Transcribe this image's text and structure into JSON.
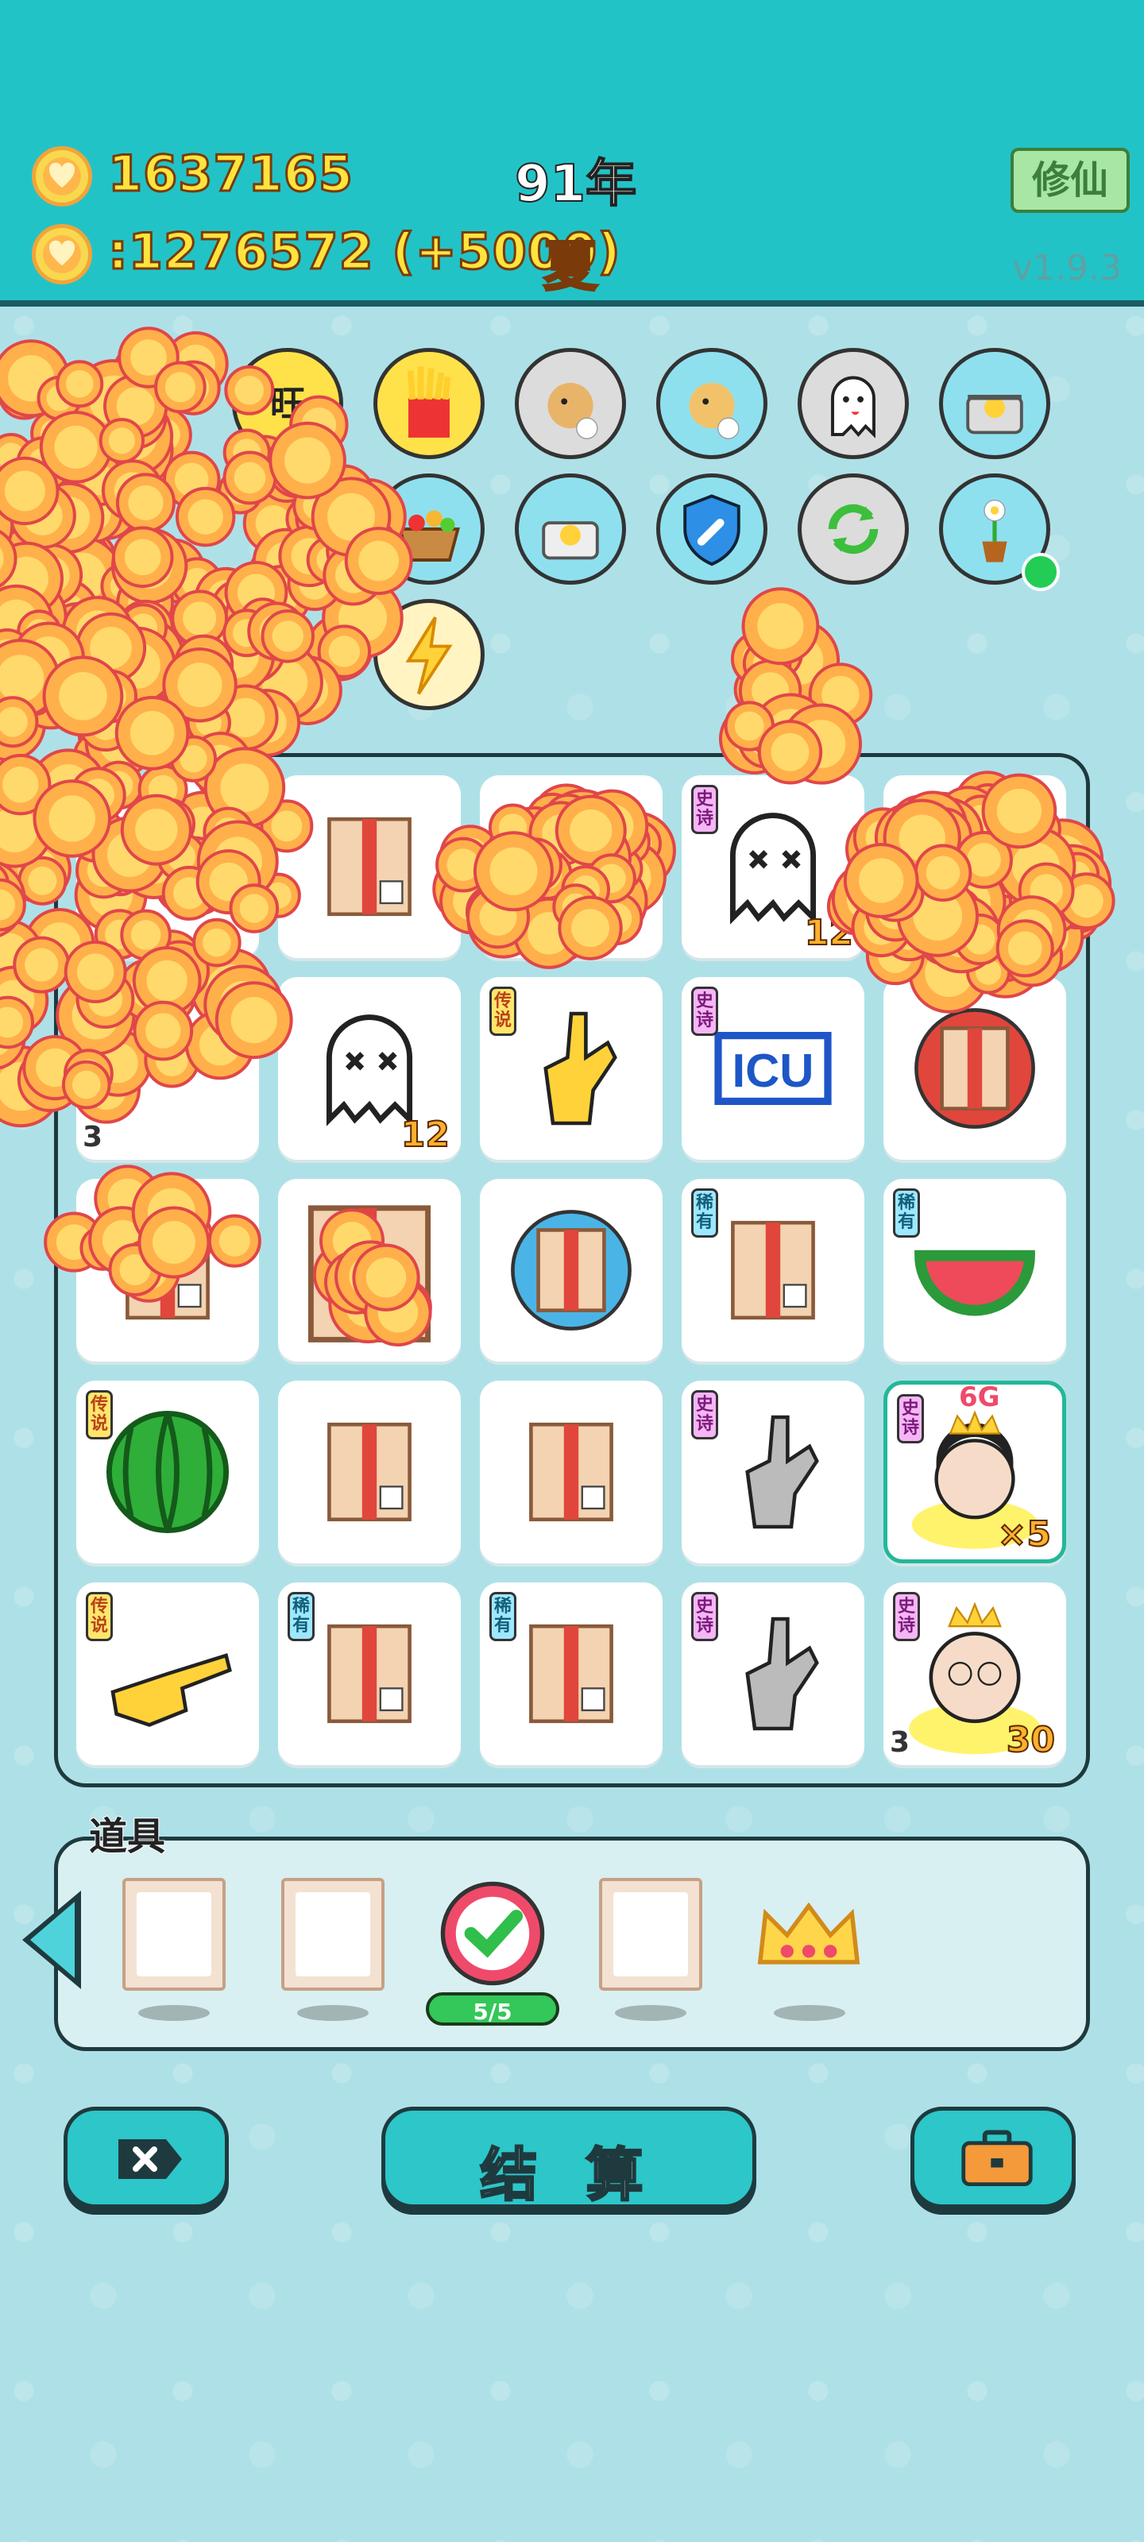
{
  "header": {
    "coins": "1637165",
    "year": "91年",
    "income": ":1276572 (+5000)",
    "season": "夏",
    "xiuxian_label": "修仙",
    "version": "v1.9.3"
  },
  "top_icons": [
    {
      "name": "wang-coin-icon"
    },
    {
      "name": "fries-icon"
    },
    {
      "name": "chicken-egg-icon"
    },
    {
      "name": "chick-egg-icon"
    },
    {
      "name": "ghost-icon"
    },
    {
      "name": "pot-icon"
    },
    {
      "name": "fruit-basket-icon"
    },
    {
      "name": "duck-pot-icon"
    },
    {
      "name": "shield-wrench-icon"
    },
    {
      "name": "recycle-icon"
    },
    {
      "name": "flower-pot-icon"
    },
    {
      "name": "lightning-icon"
    }
  ],
  "board": {
    "cells": [
      {
        "row": 0,
        "col": 0,
        "item": "hidden",
        "tag": "",
        "count": ""
      },
      {
        "row": 0,
        "col": 1,
        "item": "box",
        "tag": "",
        "count": ""
      },
      {
        "row": 0,
        "col": 2,
        "item": "hidden",
        "tag": "",
        "count": ""
      },
      {
        "row": 0,
        "col": 3,
        "item": "ghost",
        "tag": "史诗",
        "tagtype": "epic",
        "count": "12"
      },
      {
        "row": 0,
        "col": 4,
        "item": "hidden",
        "tag": "",
        "count": ""
      },
      {
        "row": 1,
        "col": 0,
        "item": "hidden",
        "tag": "",
        "count": "",
        "small": "3"
      },
      {
        "row": 1,
        "col": 1,
        "item": "ghost",
        "tag": "",
        "count": "12"
      },
      {
        "row": 1,
        "col": 2,
        "item": "hand-yellow",
        "tag": "传说",
        "tagtype": "legend",
        "count": ""
      },
      {
        "row": 1,
        "col": 3,
        "item": "icu",
        "tag": "史诗",
        "tagtype": "epic",
        "count": ""
      },
      {
        "row": 1,
        "col": 4,
        "item": "box-red",
        "tag": "",
        "count": ""
      },
      {
        "row": 2,
        "col": 0,
        "item": "box",
        "tag": "",
        "count": ""
      },
      {
        "row": 2,
        "col": 1,
        "item": "box-big",
        "tag": "",
        "count": ""
      },
      {
        "row": 2,
        "col": 2,
        "item": "box-blue",
        "tag": "",
        "count": ""
      },
      {
        "row": 2,
        "col": 3,
        "item": "box",
        "tag": "稀有",
        "tagtype": "rare",
        "count": ""
      },
      {
        "row": 2,
        "col": 4,
        "item": "watermelon-slice",
        "tag": "稀有",
        "tagtype": "rare",
        "count": ""
      },
      {
        "row": 3,
        "col": 0,
        "item": "watermelon",
        "tag": "传说",
        "tagtype": "legend",
        "count": ""
      },
      {
        "row": 3,
        "col": 1,
        "item": "box",
        "tag": "",
        "count": ""
      },
      {
        "row": 3,
        "col": 2,
        "item": "box",
        "tag": "",
        "count": ""
      },
      {
        "row": 3,
        "col": 3,
        "item": "hand-gray",
        "tag": "史诗",
        "tagtype": "epic",
        "count": ""
      },
      {
        "row": 3,
        "col": 4,
        "item": "girl-6g",
        "tag": "史诗",
        "tagtype": "epic",
        "count": "×5",
        "label6g": "6G",
        "selected": true
      },
      {
        "row": 4,
        "col": 0,
        "item": "hand-point",
        "tag": "传说",
        "tagtype": "legend",
        "count": ""
      },
      {
        "row": 4,
        "col": 1,
        "item": "box",
        "tag": "稀有",
        "tagtype": "rare",
        "count": ""
      },
      {
        "row": 4,
        "col": 2,
        "item": "box",
        "tag": "稀有",
        "tagtype": "rare",
        "count": ""
      },
      {
        "row": 4,
        "col": 3,
        "item": "hand-gray",
        "tag": "史诗",
        "tagtype": "epic",
        "count": ""
      },
      {
        "row": 4,
        "col": 4,
        "item": "grandma",
        "tag": "史诗",
        "tagtype": "epic",
        "count": "30",
        "small": "3"
      }
    ]
  },
  "props": {
    "title": "道具",
    "progress": "5/5"
  },
  "bottom": {
    "settle_label": "结 算"
  },
  "colors": {
    "header_bg": "#22c3c7",
    "coin_text": "#ffe33e",
    "accent": "#2dc6c9"
  }
}
